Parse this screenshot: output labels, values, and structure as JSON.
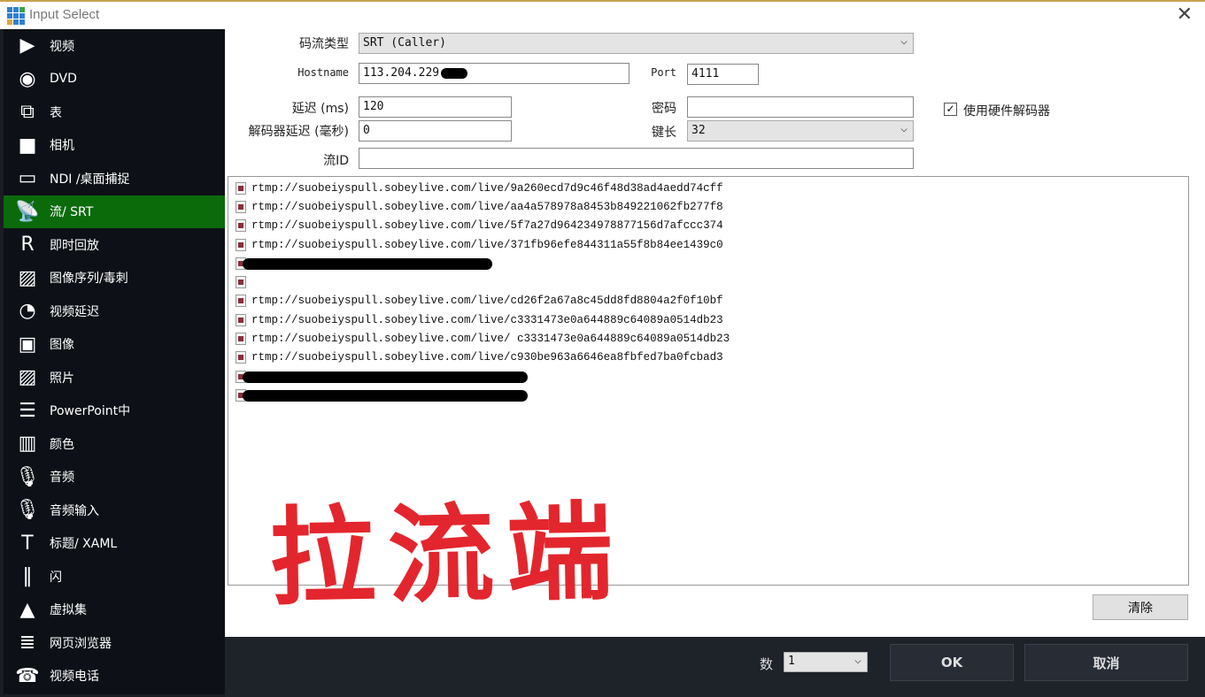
{
  "window": {
    "title": "Input Select"
  },
  "sidebar": {
    "items": [
      {
        "label": "视频",
        "icon": "video-icon"
      },
      {
        "label": "DVD",
        "icon": "disc-icon"
      },
      {
        "label": "表",
        "icon": "list-icon"
      },
      {
        "label": "相机",
        "icon": "camera-icon"
      },
      {
        "label": "NDI /桌面捕捉",
        "icon": "monitor-icon"
      },
      {
        "label": "流/ SRT",
        "icon": "antenna-icon"
      },
      {
        "label": "即时回放",
        "icon": "replay-icon"
      },
      {
        "label": "图像序列/毒刺",
        "icon": "image-sequence-icon"
      },
      {
        "label": "视频延迟",
        "icon": "timer-icon"
      },
      {
        "label": "图像",
        "icon": "image-icon"
      },
      {
        "label": "照片",
        "icon": "photos-icon"
      },
      {
        "label": "PowerPoint中",
        "icon": "presentation-icon"
      },
      {
        "label": "颜色",
        "icon": "color-icon"
      },
      {
        "label": "音频",
        "icon": "microphone-icon"
      },
      {
        "label": "音频输入",
        "icon": "microphone-icon"
      },
      {
        "label": "标题/ XAML",
        "icon": "title-icon"
      },
      {
        "label": "闪",
        "icon": "flash-icon"
      },
      {
        "label": "虚拟集",
        "icon": "virtual-set-icon"
      },
      {
        "label": "网页浏览器",
        "icon": "browser-icon"
      },
      {
        "label": "视频电话",
        "icon": "video-call-icon"
      }
    ],
    "active": "流/ SRT",
    "active_color": "#0b6b0b"
  },
  "form": {
    "stream_type_label": "码流类型",
    "stream_type": "SRT (Caller)",
    "hostname_label": "Hostname",
    "hostname": "113.204.229.",
    "port_label": "Port",
    "port": "4111",
    "latency_label": "延迟 (ms)",
    "latency": "120",
    "decoder_delay_label": "解码器延迟 (毫秒)",
    "decoder_delay": "0",
    "password_label": "密码",
    "password": "",
    "key_length_label": "键长",
    "key_length": "32",
    "hw_decoder_label": "使用硬件解码器",
    "hw_decoder_checked": true,
    "stream_id_label": "流ID",
    "stream_id": ""
  },
  "history": [
    {
      "url": "rtmp://suobeiyspull.sobeylive.com/live/9a260ecd7d9c46f48d38ad4aedd74cff"
    },
    {
      "url": "rtmp://suobeiyspull.sobeylive.com/live/aa4a578978a8453b849221062fb277f8"
    },
    {
      "url": "rtmp://suobeiyspull.sobeylive.com/live/5f7a27d964234978877156d7afccc374"
    },
    {
      "url": "rtmp://suobeiyspull.sobeylive.com/live/371fb96efe844311a55f8b84ee1439c0"
    },
    {
      "url": "",
      "redacted": true
    },
    {
      "url": ""
    },
    {
      "url": "rtmp://suobeiyspull.sobeylive.com/live/cd26f2a67a8c45dd8fd8804a2f0f10bf"
    },
    {
      "url": "rtmp://suobeiyspull.sobeylive.com/live/c3331473e0a644889c64089a0514db23"
    },
    {
      "url": "rtmp://suobeiyspull.sobeylive.com/live/ c3331473e0a644889c64089a0514db23"
    },
    {
      "url": "rtmp://suobeiyspull.sobeylive.com/live/c930be963a6646ea8fbfed7ba0fcbad3"
    },
    {
      "url": "",
      "redacted": true
    },
    {
      "url": "",
      "redacted": true
    }
  ],
  "annotation": "拉流端",
  "annotation_color": "#e3262d",
  "buttons": {
    "clear": "清除",
    "ok": "OK",
    "cancel": "取消"
  },
  "count": {
    "label": "数",
    "value": "1"
  }
}
